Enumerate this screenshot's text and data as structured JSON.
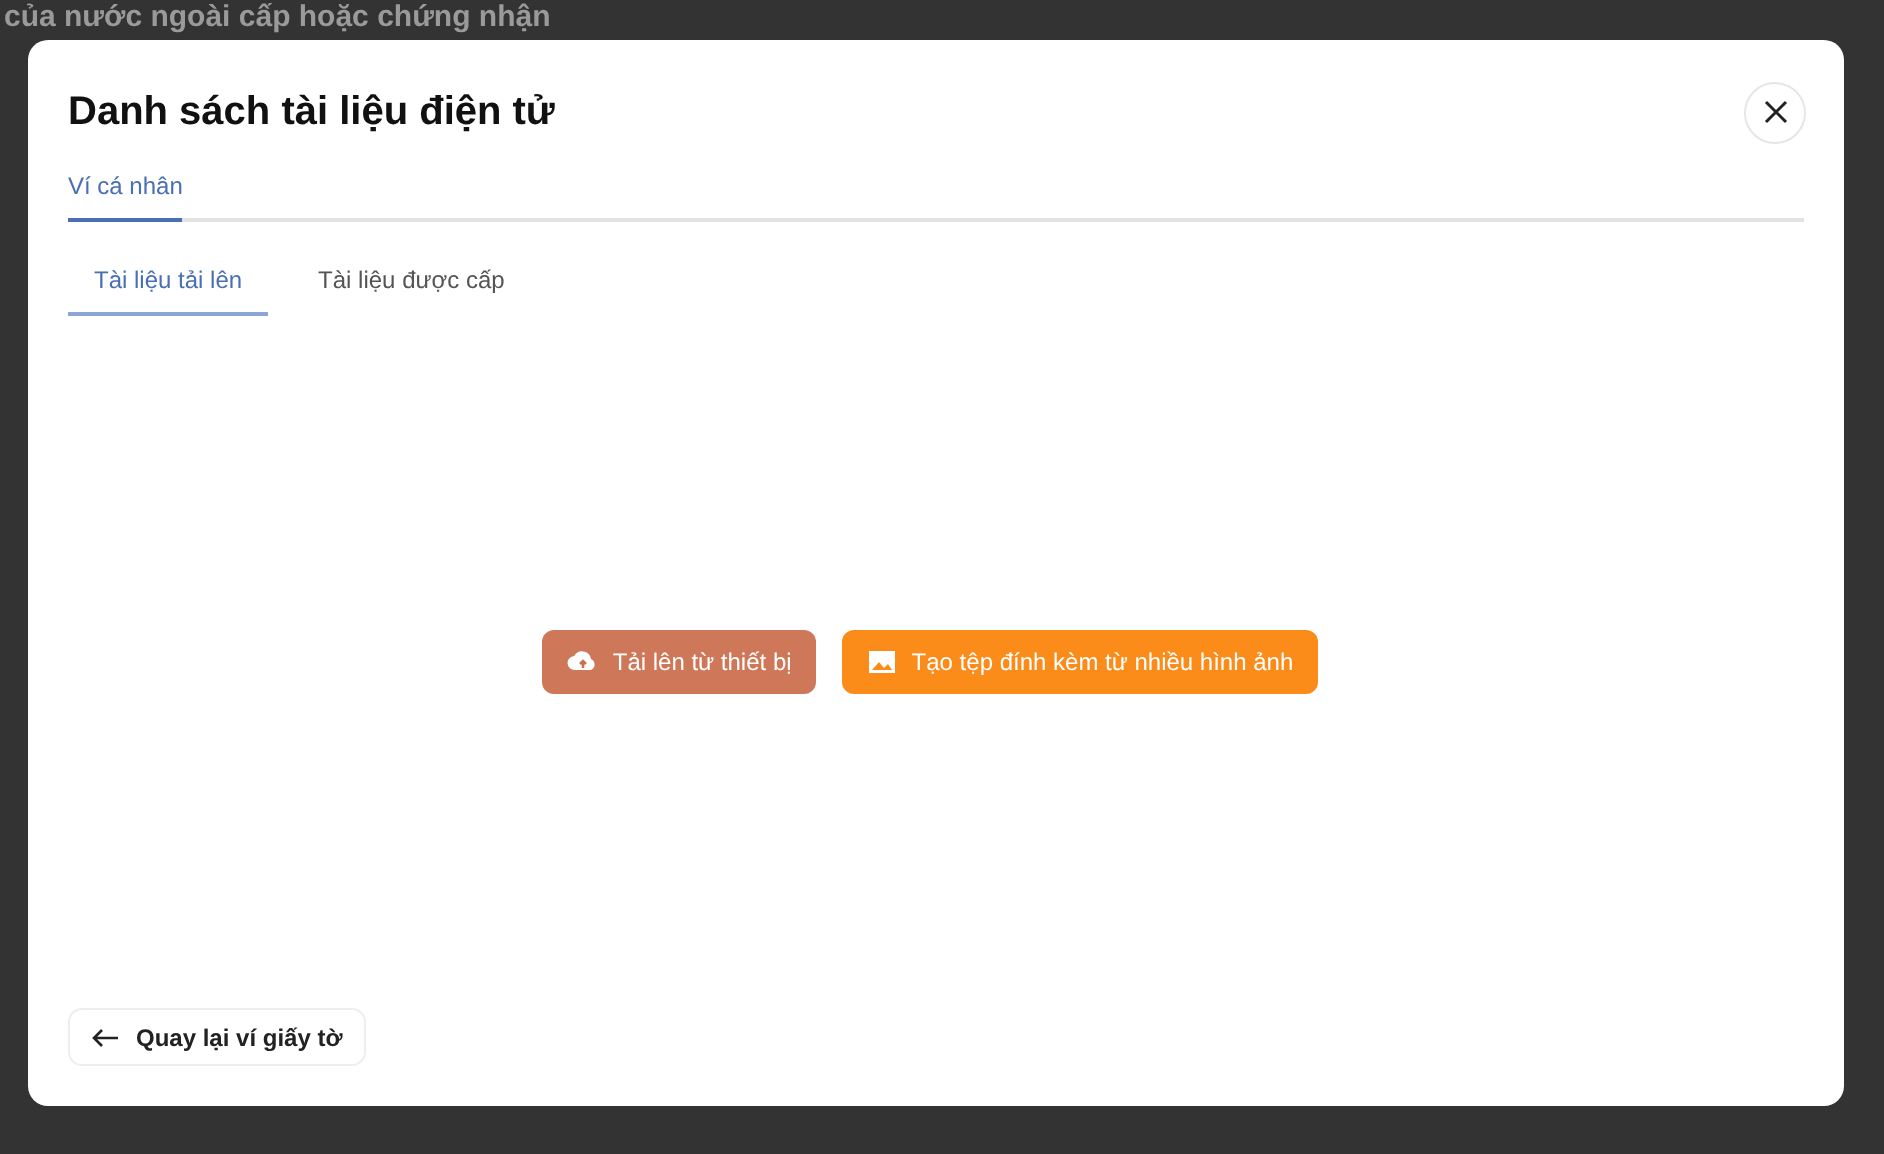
{
  "background": {
    "heading": "của nước ngoài cấp hoặc chứng nhận"
  },
  "dialog": {
    "title": "Danh sách tài liệu điện tử",
    "tabs": [
      {
        "label": "Ví cá nhân",
        "selected": true
      }
    ],
    "subtabs": [
      {
        "label": "Tài liệu tải lên",
        "selected": true
      },
      {
        "label": "Tài liệu được cấp",
        "selected": false
      }
    ],
    "actions": [
      {
        "kind": "upload",
        "label": "Tải lên từ thiết bị"
      },
      {
        "kind": "images",
        "label": "Tạo tệp đính kèm từ nhiều hình ảnh"
      }
    ],
    "back_button": "Quay lại ví giấy tờ"
  }
}
